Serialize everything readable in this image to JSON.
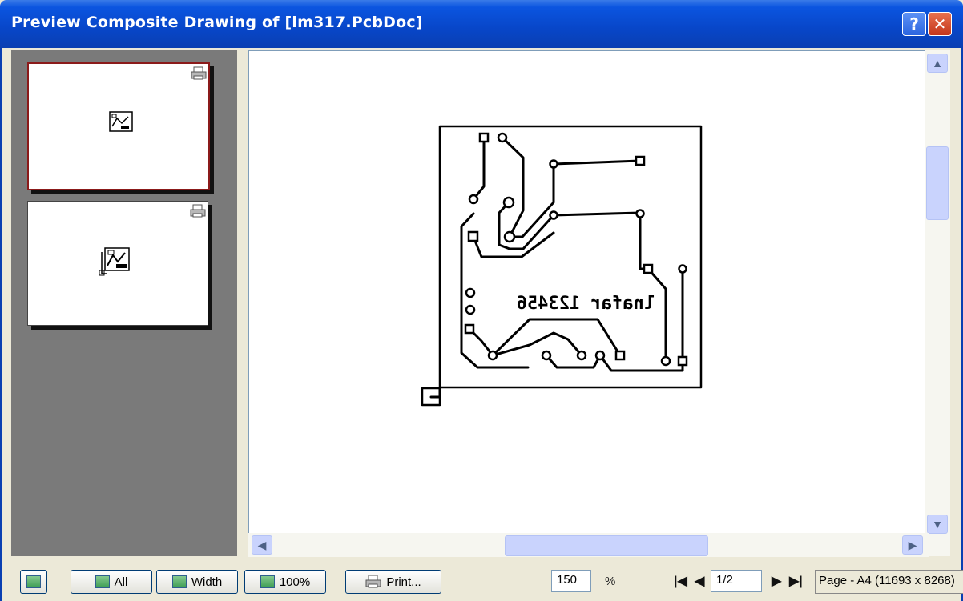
{
  "window": {
    "title": "Preview Composite Drawing of [lm317.PcbDoc]",
    "help_glyph": "?",
    "close_glyph": "✕"
  },
  "preview": {
    "silkscreen_text": "lnafar 123456"
  },
  "toolbar": {
    "all_label": "All",
    "width_label": "Width",
    "hundred_label": "100%",
    "print_label": "Print...",
    "zoom_value": "150",
    "zoom_unit": "%",
    "page_value": "1/2",
    "page_status": "Page - A4 (11693 x 8268)"
  },
  "nav": {
    "first": "|◀",
    "prev": "◀",
    "next": "▶",
    "last": "▶|"
  },
  "colors": {
    "title_bar": "#0846C8",
    "thumb_selected_border": "#8B1A1A",
    "thumb_pane": "#7A7A7A",
    "scrollbar_thumb": "#C9D3FD"
  },
  "icons": [
    "help-icon",
    "close-icon",
    "printer-icon",
    "scroll-up-icon",
    "scroll-down-icon",
    "scroll-left-icon",
    "scroll-right-icon"
  ]
}
